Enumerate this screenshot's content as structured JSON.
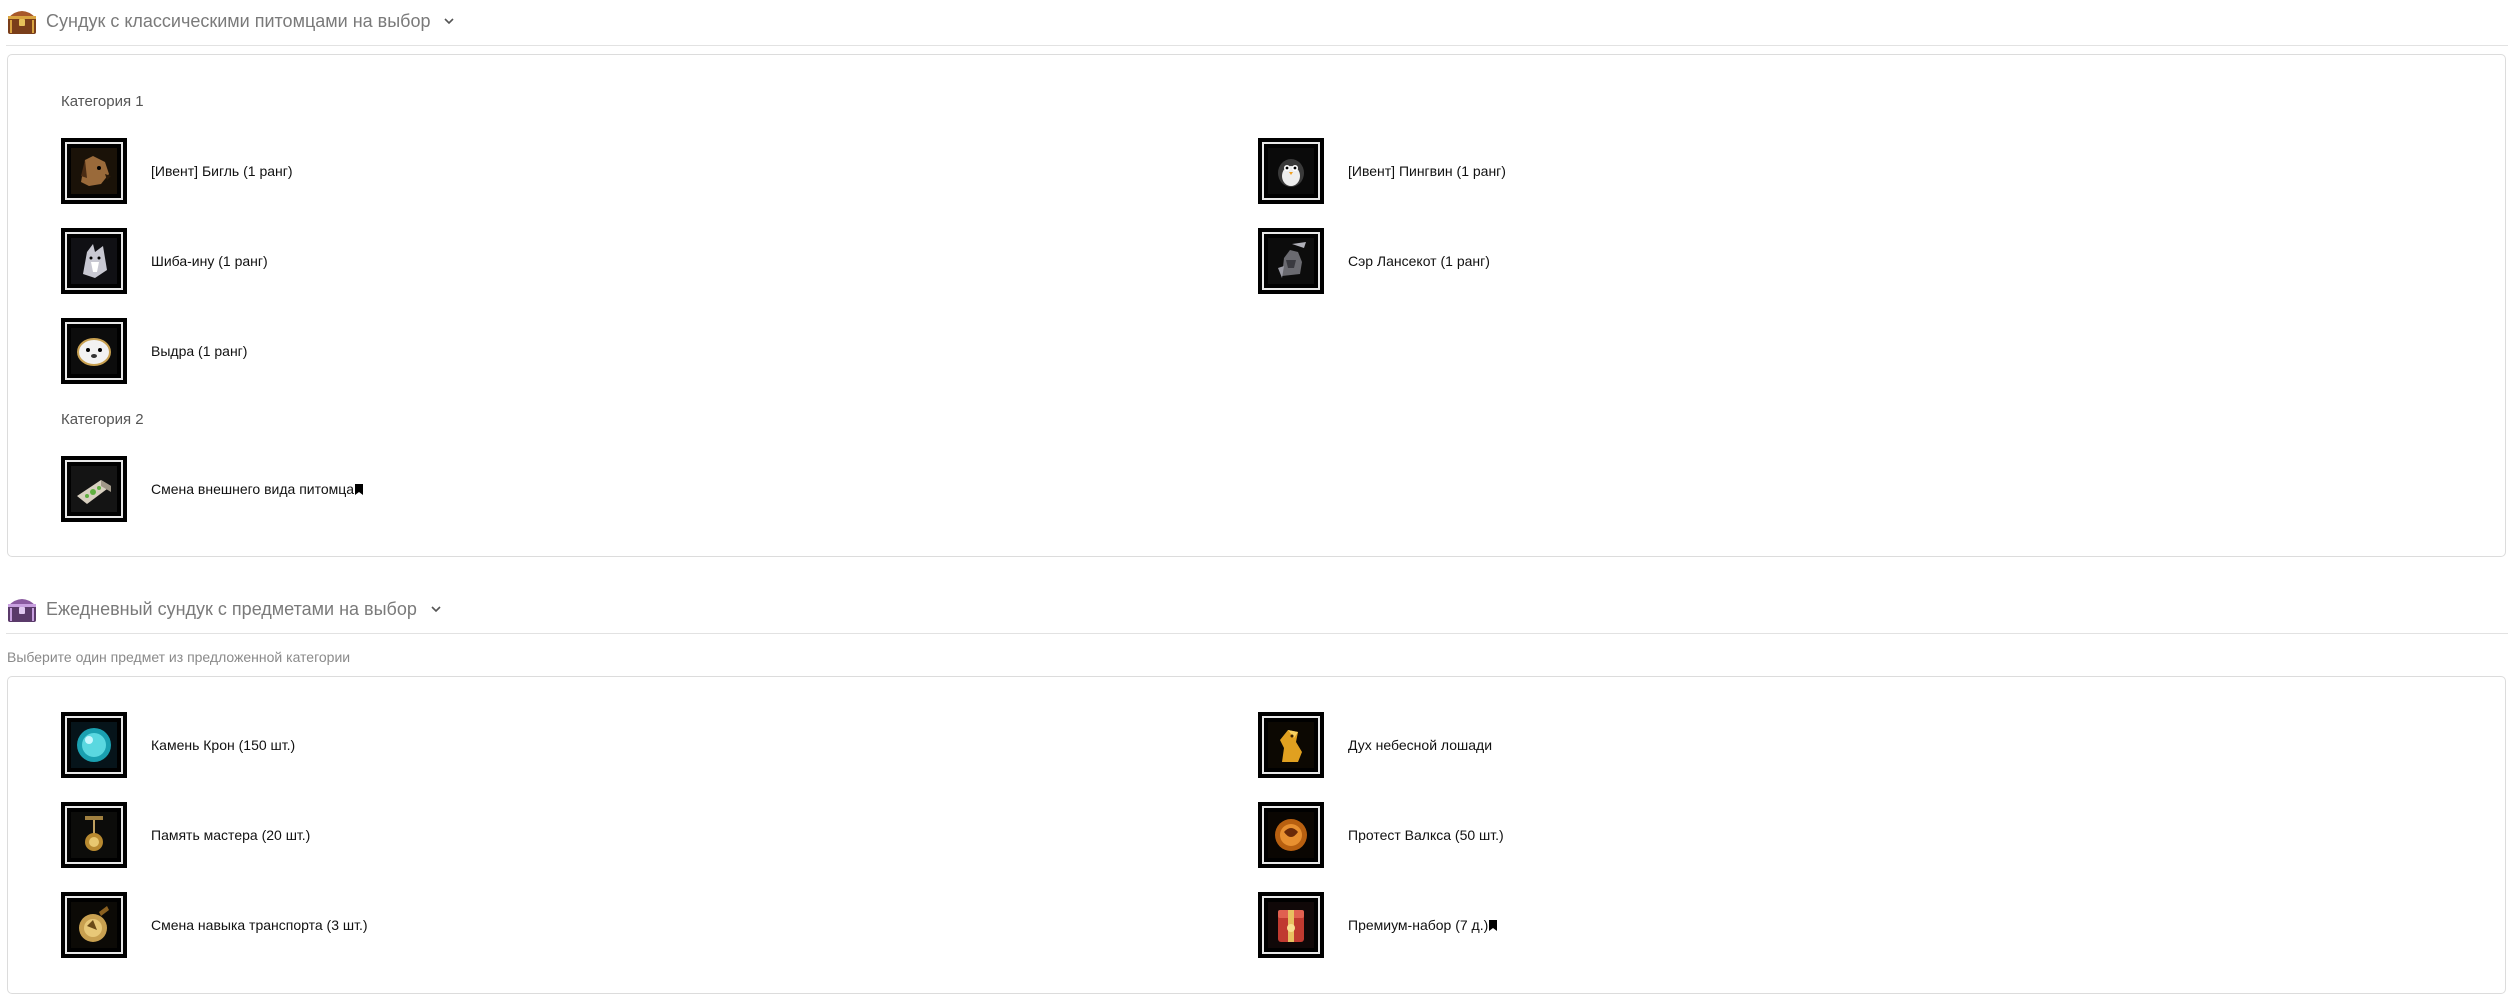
{
  "section1": {
    "title": "Сундук с классическими питомцами на выбор",
    "categories": [
      {
        "label": "Категория 1",
        "items": [
          {
            "label": "[Ивент] Бигль (1 ранг)",
            "icon": "beagle-icon"
          },
          {
            "label": "[Ивент] Пингвин (1 ранг)",
            "icon": "penguin-icon"
          },
          {
            "label": "Шиба-ину (1 ранг)",
            "icon": "shiba-icon"
          },
          {
            "label": "Сэр Лансекот (1 ранг)",
            "icon": "sir-lancecat-icon"
          },
          {
            "label": "Выдра (1 ранг)",
            "icon": "otter-icon"
          }
        ]
      },
      {
        "label": "Категория 2",
        "items": [
          {
            "label": "Смена внешнего вида питомца",
            "icon": "pet-appearance-icon",
            "bookmark": true
          }
        ]
      }
    ]
  },
  "section2": {
    "title": "Ежедневный сундук с предметами на выбор",
    "subtitle": "Выберите один предмет из предложенной категории",
    "items": [
      {
        "label": "Камень Крон (150 шт.)",
        "icon": "kron-stone-icon"
      },
      {
        "label": "Дух небесной лошади",
        "icon": "sky-horse-spirit-icon"
      },
      {
        "label": "Память мастера (20 шт.)",
        "icon": "master-memory-icon"
      },
      {
        "label": "Протест Валкса (50 шт.)",
        "icon": "valks-protest-icon"
      },
      {
        "label": "Смена навыка транспорта (3 шт.)",
        "icon": "mount-skill-change-icon"
      },
      {
        "label": "Премиум-набор (7 д.)",
        "icon": "premium-pack-icon",
        "bookmark": true
      }
    ]
  }
}
